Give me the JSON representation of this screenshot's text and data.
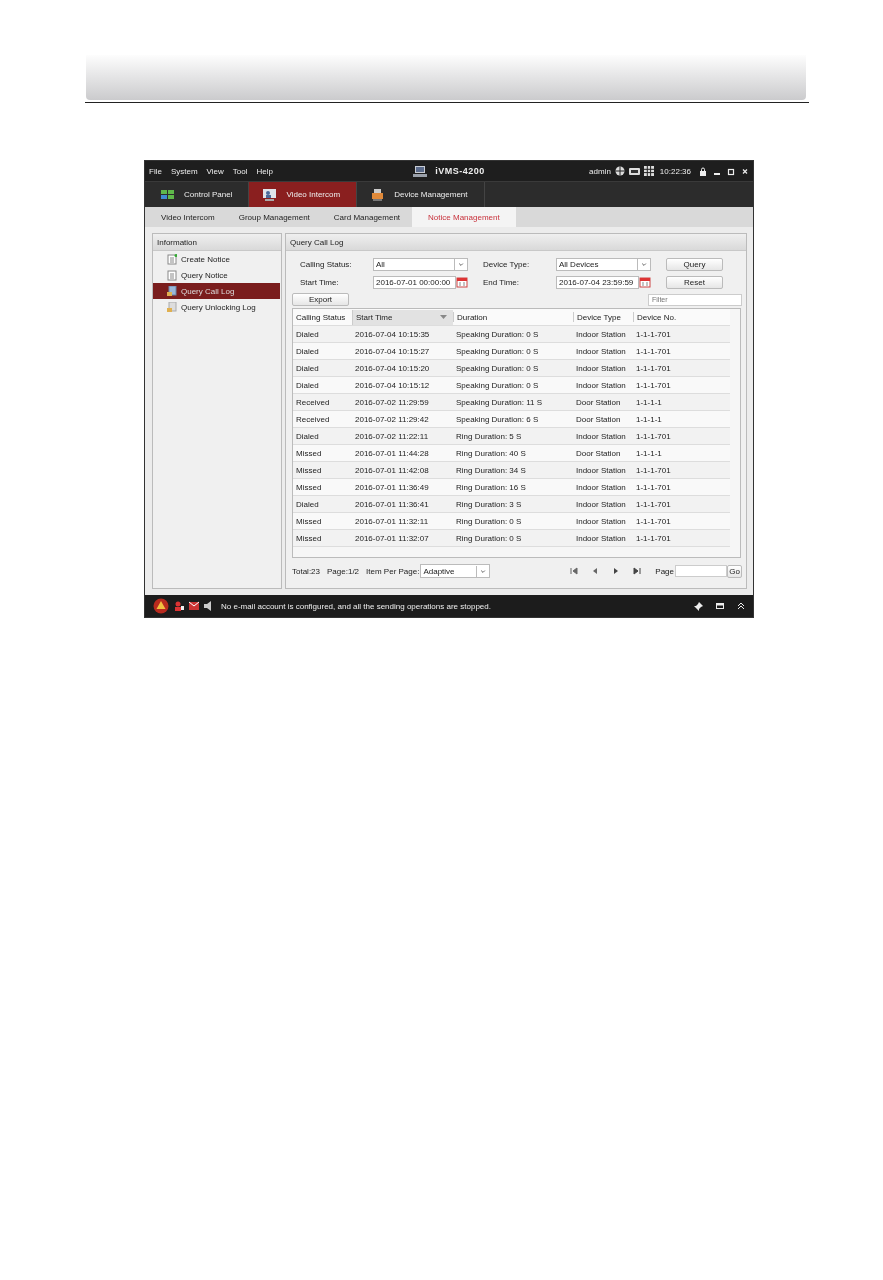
{
  "window": {
    "menu": [
      "File",
      "System",
      "View",
      "Tool",
      "Help"
    ],
    "title": "iVMS-4200",
    "user": "admin",
    "time": "10:22:36"
  },
  "modules": [
    {
      "label": "Control Panel",
      "selected": false
    },
    {
      "label": "Video Intercom",
      "selected": true
    },
    {
      "label": "Device Management",
      "selected": false
    }
  ],
  "subtabs": [
    {
      "label": "Video Intercom",
      "selected": false
    },
    {
      "label": "Group Management",
      "selected": false
    },
    {
      "label": "Card Management",
      "selected": false
    },
    {
      "label": "Notice Management",
      "selected": true
    }
  ],
  "sidebar": {
    "title": "Information",
    "items": [
      {
        "label": "Create Notice",
        "selected": false
      },
      {
        "label": "Query Notice",
        "selected": false
      },
      {
        "label": "Query Call Log",
        "selected": true
      },
      {
        "label": "Query Unlocking Log",
        "selected": false
      }
    ]
  },
  "panel": {
    "title": "Query Call Log",
    "calling_status": {
      "label": "Calling Status:",
      "value": "All"
    },
    "device_type": {
      "label": "Device Type:",
      "value": "All Devices"
    },
    "start_time": {
      "label": "Start Time:",
      "value": "2016-07-01 00:00:00"
    },
    "end_time": {
      "label": "End Time:",
      "value": "2016-07-04 23:59:59"
    },
    "query_button": "Query",
    "reset_button": "Reset",
    "export_button": "Export",
    "filter": {
      "placeholder": "Filter"
    }
  },
  "table": {
    "columns": [
      {
        "label": "Calling Status",
        "sorted": false
      },
      {
        "label": "Start Time",
        "sorted": true
      },
      {
        "label": "Duration",
        "sorted": false
      },
      {
        "label": "Device Type",
        "sorted": false
      },
      {
        "label": "Device No.",
        "sorted": false
      }
    ],
    "rows": [
      [
        "Dialed",
        "2016-07-04 10:15:35",
        "Speaking Duration: 0 S",
        "Indoor Station",
        "1-1-1-701"
      ],
      [
        "Dialed",
        "2016-07-04 10:15:27",
        "Speaking Duration: 0 S",
        "Indoor Station",
        "1-1-1-701"
      ],
      [
        "Dialed",
        "2016-07-04 10:15:20",
        "Speaking Duration: 0 S",
        "Indoor Station",
        "1-1-1-701"
      ],
      [
        "Dialed",
        "2016-07-04 10:15:12",
        "Speaking Duration: 0 S",
        "Indoor Station",
        "1-1-1-701"
      ],
      [
        "Received",
        "2016-07-02 11:29:59",
        "Speaking Duration: 11 S",
        "Door Station",
        "1-1-1-1"
      ],
      [
        "Received",
        "2016-07-02 11:29:42",
        "Speaking Duration: 6 S",
        "Door Station",
        "1-1-1-1"
      ],
      [
        "Dialed",
        "2016-07-02 11:22:11",
        "Ring Duration: 5 S",
        "Indoor Station",
        "1-1-1-701"
      ],
      [
        "Missed",
        "2016-07-01 11:44:28",
        "Ring Duration: 40 S",
        "Door Station",
        "1-1-1-1"
      ],
      [
        "Missed",
        "2016-07-01 11:42:08",
        "Ring Duration: 34 S",
        "Indoor Station",
        "1-1-1-701"
      ],
      [
        "Missed",
        "2016-07-01 11:36:49",
        "Ring Duration: 16 S",
        "Indoor Station",
        "1-1-1-701"
      ],
      [
        "Dialed",
        "2016-07-01 11:36:41",
        "Ring Duration: 3 S",
        "Indoor Station",
        "1-1-1-701"
      ],
      [
        "Missed",
        "2016-07-01 11:32:11",
        "Ring Duration: 0 S",
        "Indoor Station",
        "1-1-1-701"
      ],
      [
        "Missed",
        "2016-07-01 11:32:07",
        "Ring Duration: 0 S",
        "Indoor Station",
        "1-1-1-701"
      ]
    ]
  },
  "pager": {
    "total": "Total:23",
    "page": "Page:1/2",
    "per_page_label": "Item Per Page:",
    "per_page_value": "Adaptive",
    "page_label": "Page",
    "go_button": "Go"
  },
  "status_bar": {
    "message": "No e-mail account is configured, and all the sending operations are stopped."
  }
}
